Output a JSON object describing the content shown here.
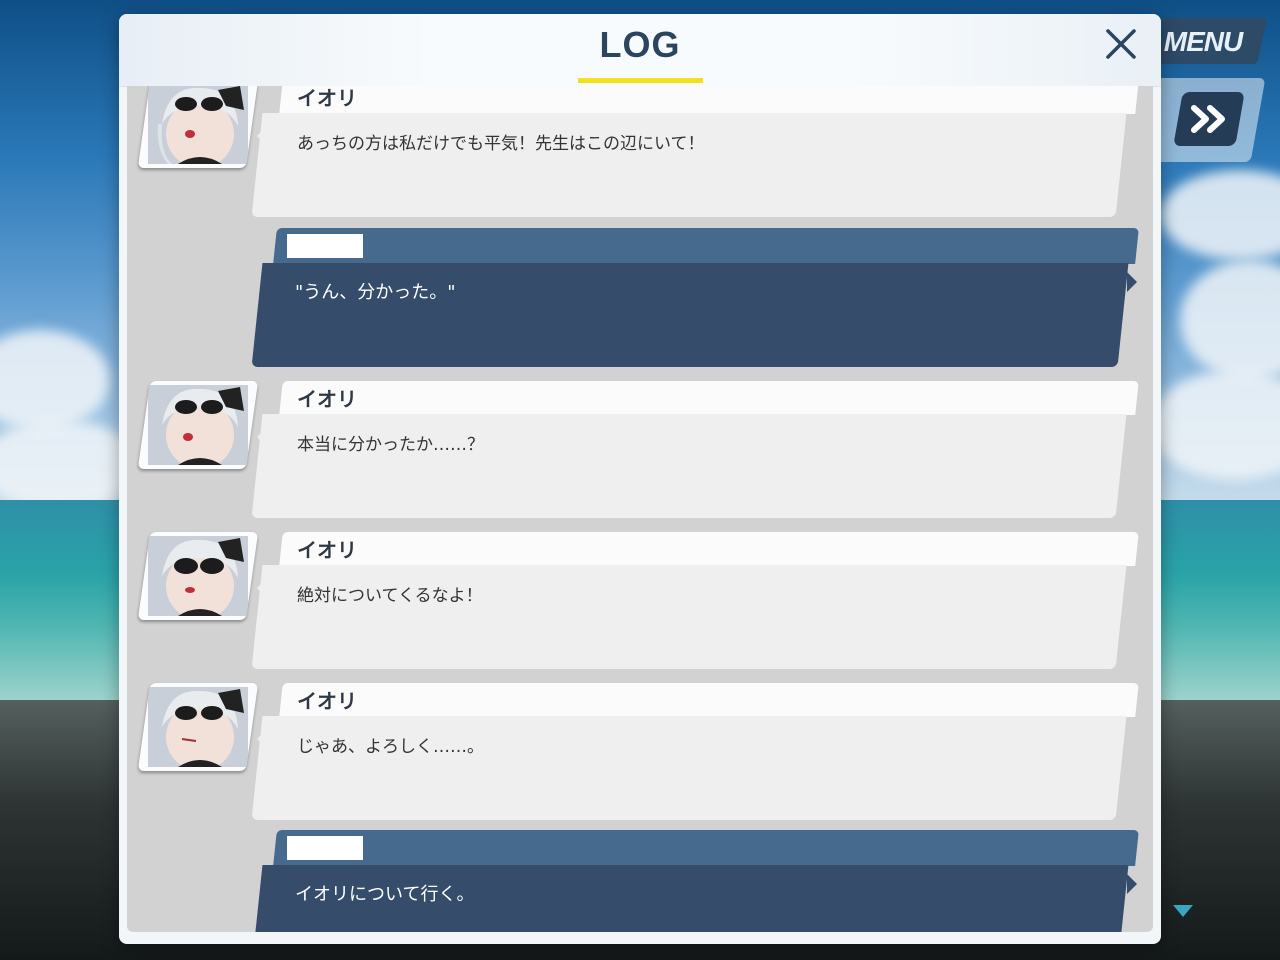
{
  "hud": {
    "menu_label": "MENU",
    "fast_forward_icon": "double-chevron-right-icon"
  },
  "log": {
    "title": "LOG",
    "close_icon": "close-icon",
    "entries": [
      {
        "kind": "character",
        "name": "イオリ",
        "text": "あっちの方は私だけでも平気！先生はこの辺にいて！"
      },
      {
        "kind": "player",
        "name": "",
        "text": "\"うん、分かった。\""
      },
      {
        "kind": "character",
        "name": "イオリ",
        "text": "本当に分かったか……？"
      },
      {
        "kind": "character",
        "name": "イオリ",
        "text": "絶対についてくるなよ！"
      },
      {
        "kind": "character",
        "name": "イオリ",
        "text": "じゃあ、よろしく……。"
      },
      {
        "kind": "player",
        "name": "",
        "text": "イオリについて行く。"
      }
    ]
  },
  "colors": {
    "accent_underline": "#f2e21c",
    "player_bubble": "#354d6a",
    "player_name_bar": "#466a8e",
    "character_bubble": "#efefef",
    "title_text": "#2b4460"
  }
}
